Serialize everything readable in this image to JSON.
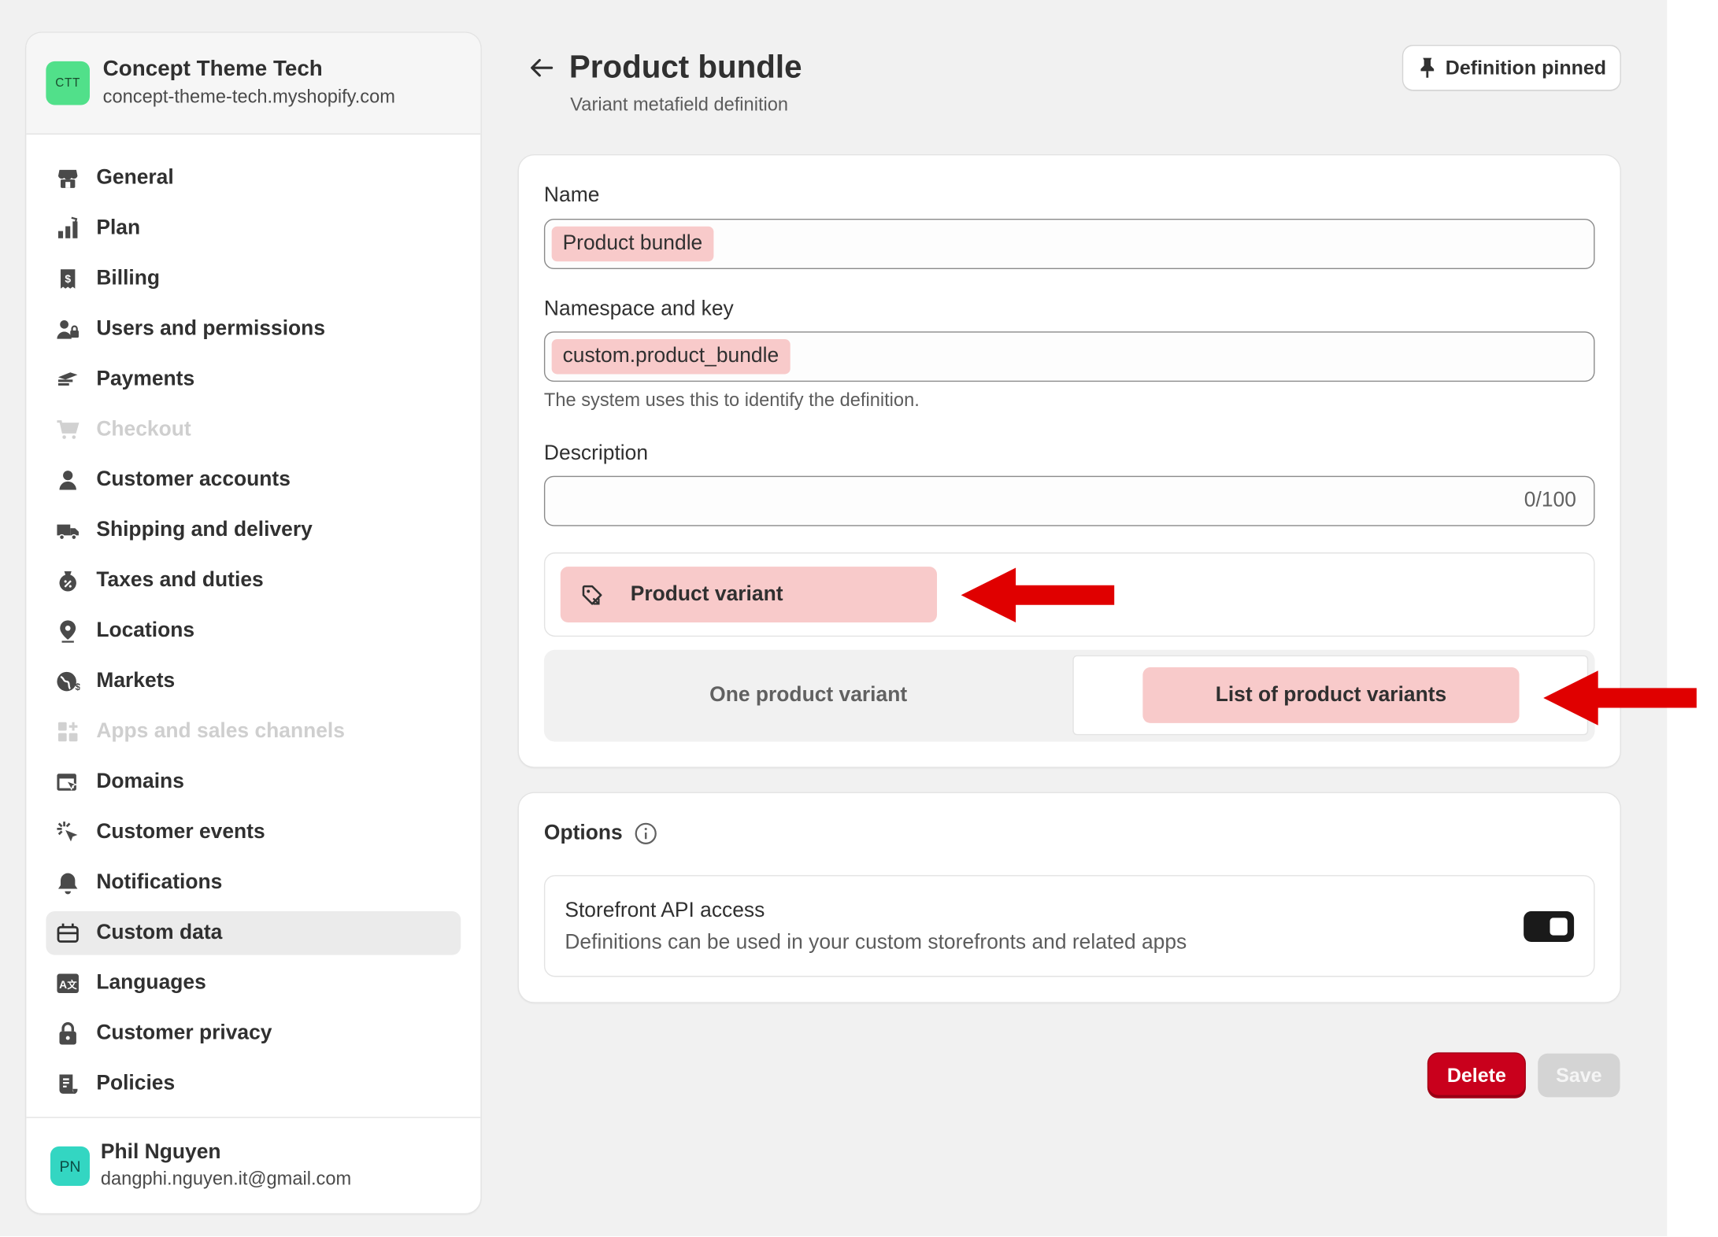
{
  "store": {
    "initials": "CTT",
    "name": "Concept Theme Tech",
    "url": "concept-theme-tech.myshopify.com"
  },
  "sidebar": {
    "items": [
      {
        "label": "General",
        "icon": "store-icon"
      },
      {
        "label": "Plan",
        "icon": "plan-icon"
      },
      {
        "label": "Billing",
        "icon": "billing-icon"
      },
      {
        "label": "Users and permissions",
        "icon": "users-icon"
      },
      {
        "label": "Payments",
        "icon": "payments-icon"
      },
      {
        "label": "Checkout",
        "icon": "cart-icon"
      },
      {
        "label": "Customer accounts",
        "icon": "person-icon"
      },
      {
        "label": "Shipping and delivery",
        "icon": "truck-icon"
      },
      {
        "label": "Taxes and duties",
        "icon": "taxes-icon"
      },
      {
        "label": "Locations",
        "icon": "location-icon"
      },
      {
        "label": "Markets",
        "icon": "globe-icon"
      },
      {
        "label": "Apps and sales channels",
        "icon": "apps-icon"
      },
      {
        "label": "Domains",
        "icon": "domains-icon"
      },
      {
        "label": "Customer events",
        "icon": "cursor-icon"
      },
      {
        "label": "Notifications",
        "icon": "bell-icon"
      },
      {
        "label": "Custom data",
        "icon": "custom-data-icon"
      },
      {
        "label": "Languages",
        "icon": "language-icon"
      },
      {
        "label": "Customer privacy",
        "icon": "lock-icon"
      },
      {
        "label": "Policies",
        "icon": "policies-icon"
      }
    ]
  },
  "user": {
    "initials": "PN",
    "name": "Phil Nguyen",
    "email": "dangphi.nguyen.it@gmail.com"
  },
  "header": {
    "title": "Product bundle",
    "subtitle": "Variant metafield definition",
    "pin_label": "Definition pinned"
  },
  "form": {
    "name_label": "Name",
    "name_value": "Product bundle",
    "namespace_label": "Namespace and key",
    "namespace_value": "custom.product_bundle",
    "namespace_help": "The system uses this to identify the definition.",
    "description_label": "Description",
    "description_count": "0/100",
    "type_label": "Product variant",
    "option_one": "One product variant",
    "option_list": "List of product variants"
  },
  "options": {
    "title": "Options",
    "storefront_title": "Storefront API access",
    "storefront_desc": "Definitions can be used in your custom storefronts and related apps",
    "storefront_enabled": true
  },
  "actions": {
    "delete_label": "Delete",
    "save_label": "Save"
  },
  "colors": {
    "highlight": "#f8caca",
    "delete": "#c9001c",
    "annotation_arrow": "#e00000",
    "store_avatar": "#51e08a",
    "user_avatar": "#33d6c2"
  }
}
